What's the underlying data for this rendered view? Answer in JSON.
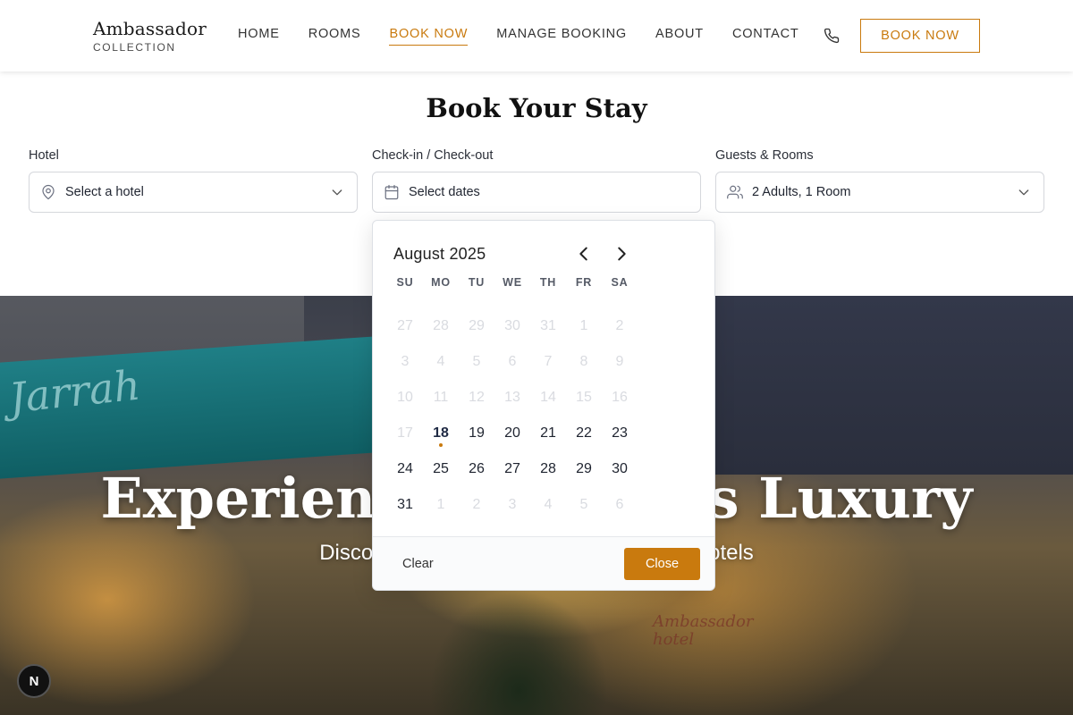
{
  "brand": {
    "name": "Ambassador",
    "sub": "COLLECTION"
  },
  "nav": {
    "items": [
      {
        "label": "HOME",
        "active": false
      },
      {
        "label": "ROOMS",
        "active": false
      },
      {
        "label": "BOOK NOW",
        "active": true
      },
      {
        "label": "MANAGE BOOKING",
        "active": false
      },
      {
        "label": "ABOUT",
        "active": false
      },
      {
        "label": "CONTACT",
        "active": false
      }
    ],
    "phone_icon": "phone-icon",
    "book_button": "BOOK NOW"
  },
  "booking": {
    "title": "Book Your Stay",
    "hotel": {
      "label": "Hotel",
      "value": "Select a hotel",
      "icon": "map-pin-icon"
    },
    "dates": {
      "label": "Check-in / Check-out",
      "value": "Select dates",
      "icon": "calendar-icon"
    },
    "guests": {
      "label": "Guests & Rooms",
      "value": "2 Adults, 1 Room",
      "icon": "users-icon"
    }
  },
  "calendar": {
    "month": "August 2025",
    "weekdays": [
      "SU",
      "MO",
      "TU",
      "WE",
      "TH",
      "FR",
      "SA"
    ],
    "weeks": [
      [
        "27",
        "28",
        "29",
        "30",
        "31",
        "1",
        "2"
      ],
      [
        "3",
        "4",
        "5",
        "6",
        "7",
        "8",
        "9"
      ],
      [
        "10",
        "11",
        "12",
        "13",
        "14",
        "15",
        "16"
      ],
      [
        "17",
        "18",
        "19",
        "20",
        "21",
        "22",
        "23"
      ],
      [
        "24",
        "25",
        "26",
        "27",
        "28",
        "29",
        "30"
      ],
      [
        "31",
        "1",
        "2",
        "3",
        "4",
        "5",
        "6"
      ]
    ],
    "today": "18",
    "clear_label": "Clear",
    "close_label": "Close",
    "accent": "#c97a0e"
  },
  "hero": {
    "title": "Experience Timeless Luxury",
    "subtitle": "Discover our collection of distinguished hotels",
    "awning_text": "Jarrah",
    "sign_line1": "Ambassador",
    "sign_line2": "hotel"
  },
  "badge": {
    "label": "N"
  }
}
